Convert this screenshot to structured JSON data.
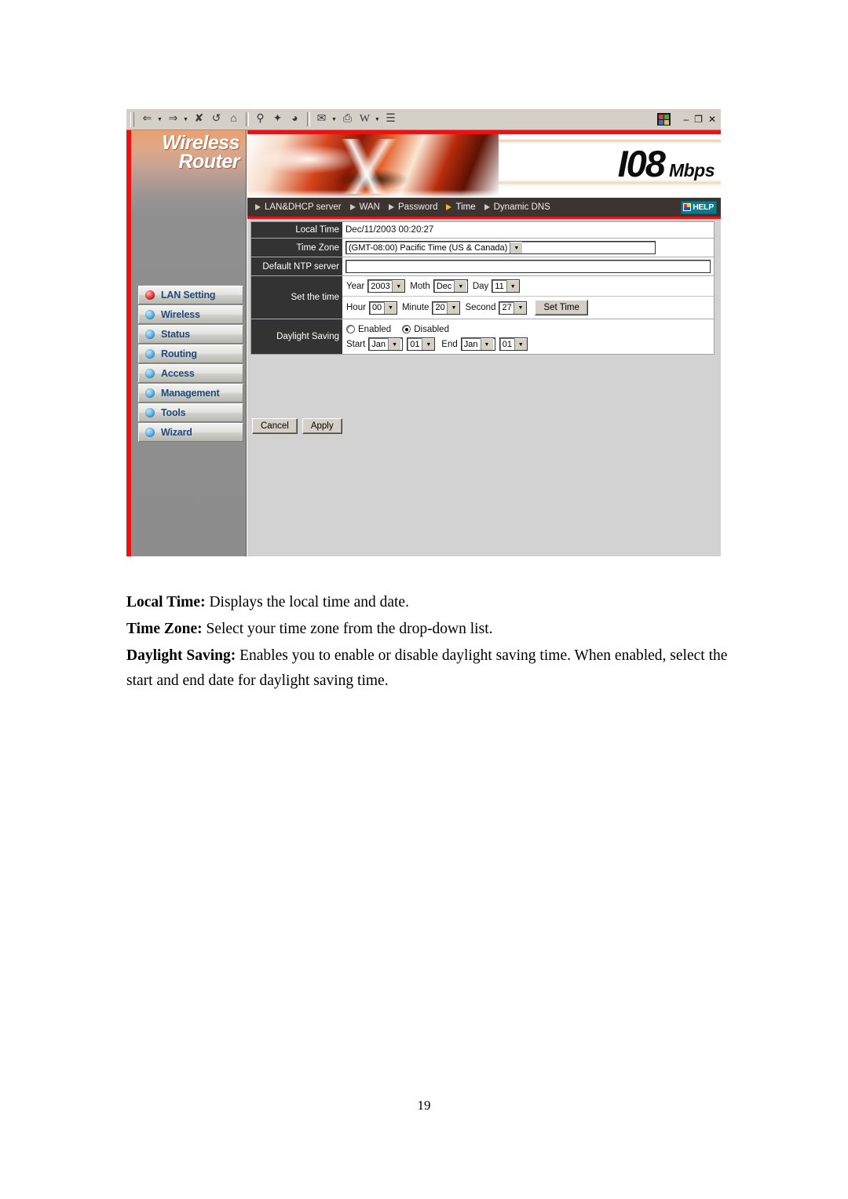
{
  "browser": {
    "toolbar_icons": [
      {
        "name": "back-icon",
        "glyph": "⇐",
        "caret": true
      },
      {
        "name": "forward-icon",
        "glyph": "⇒",
        "caret": true
      },
      {
        "name": "stop-icon",
        "glyph": "⊗",
        "caret": false
      },
      {
        "name": "refresh-icon",
        "glyph": "↻",
        "caret": false
      },
      {
        "name": "home-icon",
        "glyph": "⌂",
        "caret": false
      },
      {
        "name": "search-icon",
        "glyph": "⌕",
        "caret": false
      },
      {
        "name": "favorites-icon",
        "glyph": "★",
        "caret": false
      },
      {
        "name": "history-icon",
        "glyph": "◔",
        "caret": false
      },
      {
        "name": "mail-icon",
        "glyph": "✉",
        "caret": true
      },
      {
        "name": "print-icon",
        "glyph": "⎙",
        "caret": false
      },
      {
        "name": "edit-word-icon",
        "glyph": "W",
        "caret": true
      },
      {
        "name": "discuss-icon",
        "glyph": "≡",
        "caret": false
      }
    ],
    "window_controls": {
      "minimize": "–",
      "restore": "❐",
      "close": "✕"
    }
  },
  "sidebar": {
    "brand_line1": "Wireless",
    "brand_line2": "Router",
    "items": [
      {
        "label": "LAN Setting",
        "active": true
      },
      {
        "label": "Wireless",
        "active": false
      },
      {
        "label": "Status",
        "active": false
      },
      {
        "label": "Routing",
        "active": false
      },
      {
        "label": "Access",
        "active": false
      },
      {
        "label": "Management",
        "active": false
      },
      {
        "label": "Tools",
        "active": false
      },
      {
        "label": "Wizard",
        "active": false
      }
    ]
  },
  "banner": {
    "logo_number": "I08",
    "logo_unit": "Mbps"
  },
  "nav": {
    "items": [
      {
        "label": "LAN&DHCP server",
        "active": false
      },
      {
        "label": "WAN",
        "active": false
      },
      {
        "label": "Password",
        "active": false
      },
      {
        "label": "Time",
        "active": true
      },
      {
        "label": "Dynamic DNS",
        "active": false
      }
    ],
    "help_label": "HELP"
  },
  "form": {
    "local_time": {
      "label": "Local Time",
      "value": "Dec/11/2003 00:20:27"
    },
    "time_zone": {
      "label": "Time Zone",
      "value": "(GMT-08:00) Pacific Time (US & Canada)"
    },
    "ntp": {
      "label": "Default NTP server",
      "value": "",
      "placeholder": ""
    },
    "set_time": {
      "label": "Set the time",
      "year_label": "Year",
      "year_value": "2003",
      "month_label": "Moth",
      "month_value": "Dec",
      "day_label": "Day",
      "day_value": "11",
      "hour_label": "Hour",
      "hour_value": "00",
      "minute_label": "Minute",
      "minute_value": "20",
      "second_label": "Second",
      "second_value": "27",
      "set_button": "Set Time"
    },
    "daylight": {
      "label": "Daylight Saving",
      "enabled_label": "Enabled",
      "disabled_label": "Disabled",
      "selected": "Disabled",
      "start_label": "Start",
      "start_month": "Jan",
      "start_day": "01",
      "end_label": "End",
      "end_month": "Jan",
      "end_day": "01"
    }
  },
  "actions": {
    "cancel_label": "Cancel",
    "apply_label": "Apply"
  },
  "doc": {
    "para1_term": "Local Time:",
    "para1_text": " Displays the local time and date.",
    "para2_term": "Time Zone:",
    "para2_text": " Select your time zone from the drop-down list.",
    "para3_term": "Daylight Saving:",
    "para3_text": " Enables you to enable or disable daylight saving time. When enabled, select the start and end date for daylight saving time.",
    "page_number": "19"
  },
  "colors": {
    "accent_red": "#ee1111",
    "label_dark": "#333333",
    "nav_bg": "#3b3431",
    "sidebar_gray": "#8d8d8d",
    "link_blue": "#23497a",
    "help_teal": "#0c7a8c",
    "active_arrow": "#f4b520"
  }
}
